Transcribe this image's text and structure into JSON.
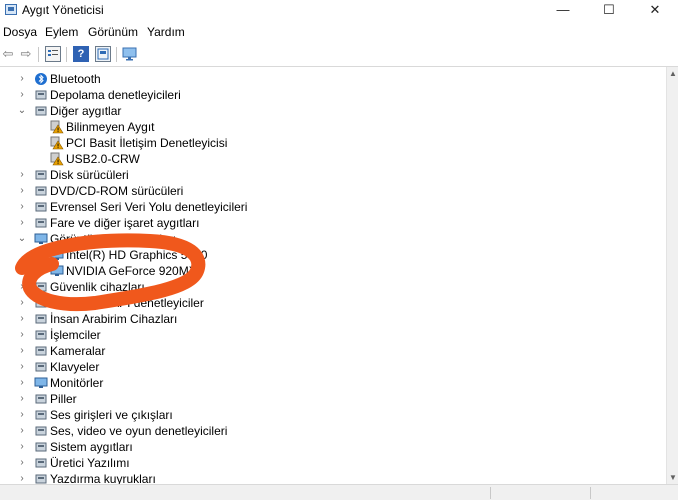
{
  "window": {
    "title": "Aygıt Yöneticisi",
    "minimize": "—",
    "maximize": "☐",
    "close": "✕"
  },
  "menu": [
    "Dosya",
    "Eylem",
    "Görünüm",
    "Yardım"
  ],
  "toolbar": {
    "back": "⇦",
    "forward": "⇨",
    "help": "?"
  },
  "colors": {
    "annotation": "#f0581c",
    "warning": "#e8a000"
  },
  "tree": [
    {
      "label": "Bluetooth",
      "level": 1,
      "expanded": false,
      "icon": "bluetooth-icon"
    },
    {
      "label": "Depolama denetleyicileri",
      "level": 1,
      "expanded": false,
      "icon": "storage-controller-icon"
    },
    {
      "label": "Diğer aygıtlar",
      "level": 1,
      "expanded": true,
      "icon": "other-devices-icon"
    },
    {
      "label": "Bilinmeyen Aygıt",
      "level": 2,
      "icon": "unknown-device-warning-icon"
    },
    {
      "label": "PCI Basit İletişim Denetleyicisi",
      "level": 2,
      "icon": "unknown-device-warning-icon"
    },
    {
      "label": "USB2.0-CRW",
      "level": 2,
      "icon": "unknown-device-warning-icon"
    },
    {
      "label": "Disk sürücüleri",
      "level": 1,
      "expanded": false,
      "icon": "disk-drive-icon"
    },
    {
      "label": "DVD/CD-ROM sürücüleri",
      "level": 1,
      "expanded": false,
      "icon": "dvd-drive-icon"
    },
    {
      "label": "Evrensel Seri Veri Yolu denetleyicileri",
      "level": 1,
      "expanded": false,
      "icon": "usb-icon"
    },
    {
      "label": "Fare ve diğer işaret aygıtları",
      "level": 1,
      "expanded": false,
      "icon": "mouse-icon"
    },
    {
      "label": "Görüntü bağdaştırıcıları",
      "level": 1,
      "expanded": true,
      "icon": "display-adapter-icon"
    },
    {
      "label": "Intel(R) HD Graphics 5500",
      "level": 2,
      "icon": "display-adapter-icon"
    },
    {
      "label": "NVIDIA GeForce 920MX",
      "level": 2,
      "icon": "display-adapter-icon"
    },
    {
      "label": "Güvenlik cihazları",
      "level": 1,
      "expanded": false,
      "icon": "security-device-icon"
    },
    {
      "label": "IDE ATA/ATAPI denetleyiciler",
      "level": 1,
      "expanded": false,
      "icon": "ide-controller-icon"
    },
    {
      "label": "İnsan Arabirim Cihazları",
      "level": 1,
      "expanded": false,
      "icon": "hid-icon"
    },
    {
      "label": "İşlemciler",
      "level": 1,
      "expanded": false,
      "icon": "processor-icon"
    },
    {
      "label": "Kameralar",
      "level": 1,
      "expanded": false,
      "icon": "camera-icon"
    },
    {
      "label": "Klavyeler",
      "level": 1,
      "expanded": false,
      "icon": "keyboard-icon"
    },
    {
      "label": "Monitörler",
      "level": 1,
      "expanded": false,
      "icon": "monitor-icon"
    },
    {
      "label": "Piller",
      "level": 1,
      "expanded": false,
      "icon": "battery-icon"
    },
    {
      "label": "Ses girişleri ve çıkışları",
      "level": 1,
      "expanded": false,
      "icon": "speaker-icon"
    },
    {
      "label": "Ses, video ve oyun denetleyicileri",
      "level": 1,
      "expanded": false,
      "icon": "audio-controller-icon"
    },
    {
      "label": "Sistem aygıtları",
      "level": 1,
      "expanded": false,
      "icon": "system-device-icon"
    },
    {
      "label": "Üretici Yazılımı",
      "level": 1,
      "expanded": false,
      "icon": "firmware-icon"
    },
    {
      "label": "Yazdırma kuyrukları",
      "level": 1,
      "expanded": false,
      "icon": "print-queue-icon"
    }
  ]
}
